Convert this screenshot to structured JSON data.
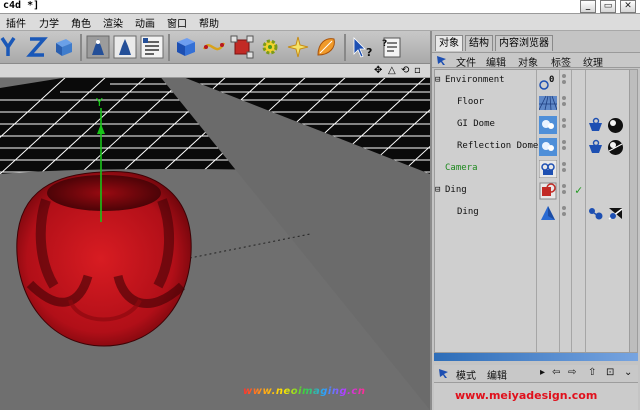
{
  "window": {
    "title": "c4d *]",
    "buttons": {
      "minimize": "_",
      "restore": "▭",
      "close": "✕"
    }
  },
  "menubar": {
    "items": [
      "插件",
      "力学",
      "角色",
      "渲染",
      "动画",
      "窗口",
      "帮助"
    ]
  },
  "toolbar": {
    "icons": [
      "y-axis-icon",
      "z-axis-icon",
      "world-coordinates-icon",
      "render-view-icon",
      "render-picture-viewer-icon",
      "render-settings-icon",
      "cube-primitive-icon",
      "spline-icon",
      "nurbs-icon",
      "array-icon",
      "light-icon",
      "deformer-icon",
      "help-cursor-icon",
      "script-icon"
    ]
  },
  "viewport": {
    "header_glyphs": [
      "✥",
      "△",
      "⟲",
      "▫"
    ],
    "axis_label": "Y",
    "object": {
      "color": "#b5101b",
      "shape": "rounded cube with spherical cutouts"
    }
  },
  "panel": {
    "tabs": [
      "对象",
      "结构",
      "内容浏览器"
    ],
    "active_tab": "对象",
    "om_menu": [
      "文件",
      "编辑",
      "对象",
      "标签",
      "纹理"
    ],
    "objects": [
      {
        "name": "Environment",
        "indent": 0,
        "color": "#111111",
        "icon": "null-object-icon",
        "expander": "⊟",
        "tags": []
      },
      {
        "name": "Floor",
        "indent": 1,
        "color": "#111111",
        "icon": "floor-object-icon",
        "tags": []
      },
      {
        "name": "GI Dome",
        "indent": 1,
        "color": "#111111",
        "icon": "sky-object-icon",
        "tags": [
          "compositing-tag-icon",
          "material-tag-icon"
        ]
      },
      {
        "name": "Reflection Dome",
        "indent": 1,
        "color": "#111111",
        "icon": "sky-object-icon",
        "tags": [
          "compositing-tag-icon",
          "material-tag-icon"
        ]
      },
      {
        "name": "Camera",
        "indent": 0,
        "color": "#1f8a1f",
        "icon": "camera-object-icon",
        "tags": []
      },
      {
        "name": "Ding",
        "indent": 0,
        "color": "#111111",
        "icon": "boole-object-icon",
        "expander": "⊟",
        "check": "✓",
        "tags": []
      },
      {
        "name": "Ding",
        "indent": 1,
        "color": "#111111",
        "icon": "polygon-object-icon",
        "tags": [
          "phong-tag-icon",
          "material-tag-icon"
        ]
      }
    ],
    "attributes": {
      "menu": [
        "模式",
        "编辑"
      ],
      "nav_glyphs": [
        "▸",
        "⇦",
        "⇨",
        "⇧",
        "⊡",
        "⌄"
      ]
    }
  },
  "watermarks": {
    "left": "www.neoimaging.cn",
    "right": "www.meiyadesign.com"
  }
}
